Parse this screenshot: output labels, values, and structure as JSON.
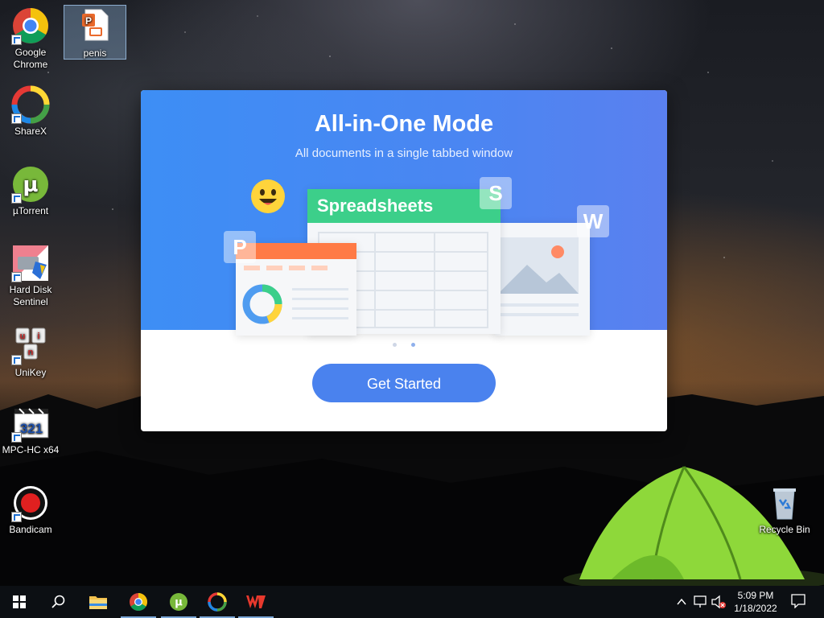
{
  "desktop": {
    "icons": [
      {
        "label": "Google Chrome"
      },
      {
        "label": "penis"
      },
      {
        "label": "ShareX"
      },
      {
        "label": "µTorrent"
      },
      {
        "label": "Hard Disk Sentinel"
      },
      {
        "label": "UniKey"
      },
      {
        "label": "MPC-HC x64"
      },
      {
        "label": "Bandicam"
      },
      {
        "label": "Recycle Bin"
      }
    ]
  },
  "dialog": {
    "title": "All-in-One Mode",
    "subtitle": "All documents in a single tabbed window",
    "illustration": {
      "spreadsheet_label": "Spreadsheets",
      "badge_s": "S",
      "badge_w": "W",
      "badge_p": "P"
    },
    "pager": {
      "count": 2,
      "active_index": 1
    },
    "button_label": "Get Started"
  },
  "taskbar": {
    "pinned": [
      "start-icon",
      "search-icon",
      "file-explorer-icon",
      "chrome-icon",
      "utorrent-icon",
      "sharex-icon",
      "wps-office-icon"
    ],
    "clock": {
      "time": "5:09 PM",
      "date": "1/18/2022"
    }
  },
  "colors": {
    "dialog_accent": "#4a82ee",
    "spreadsheet_green": "#3ccf8a",
    "presentation_orange": "#ff7a45",
    "taskbar_bg": "#0c0f13"
  }
}
